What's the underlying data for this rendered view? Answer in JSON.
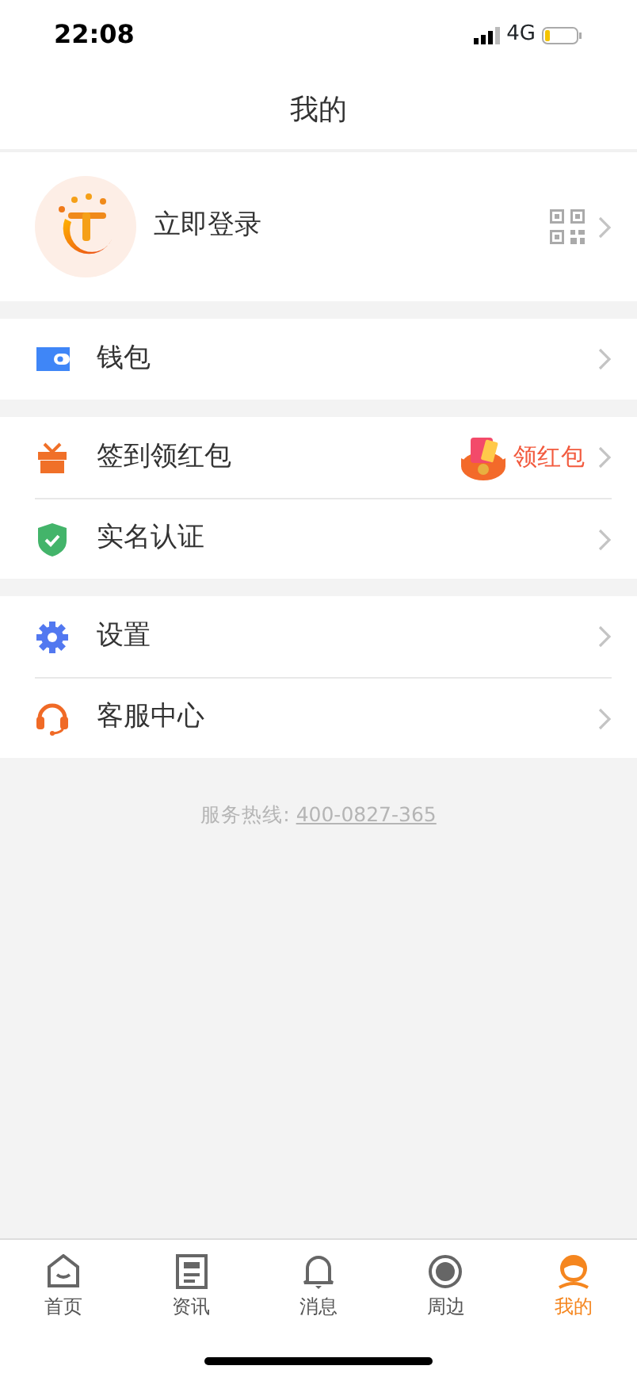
{
  "status_bar": {
    "time": "22:08",
    "network": "4G"
  },
  "header": {
    "title": "我的"
  },
  "profile": {
    "login": "立即登录"
  },
  "menu_groups": [
    {
      "items": [
        {
          "label": "钱包"
        }
      ]
    },
    {
      "items": [
        {
          "label": "签到领红包",
          "badge": "领红包"
        },
        {
          "label": "实名认证"
        }
      ]
    },
    {
      "items": [
        {
          "label": "设置"
        },
        {
          "label": "客服中心"
        }
      ]
    }
  ],
  "hotline": {
    "label": "服务热线:",
    "number": "400-0827-365"
  },
  "tabs": [
    {
      "label": "首页",
      "selected": false
    },
    {
      "label": "资讯",
      "selected": false
    },
    {
      "label": "消息",
      "selected": false
    },
    {
      "label": "周边",
      "selected": false
    },
    {
      "label": "我的",
      "selected": true
    }
  ]
}
